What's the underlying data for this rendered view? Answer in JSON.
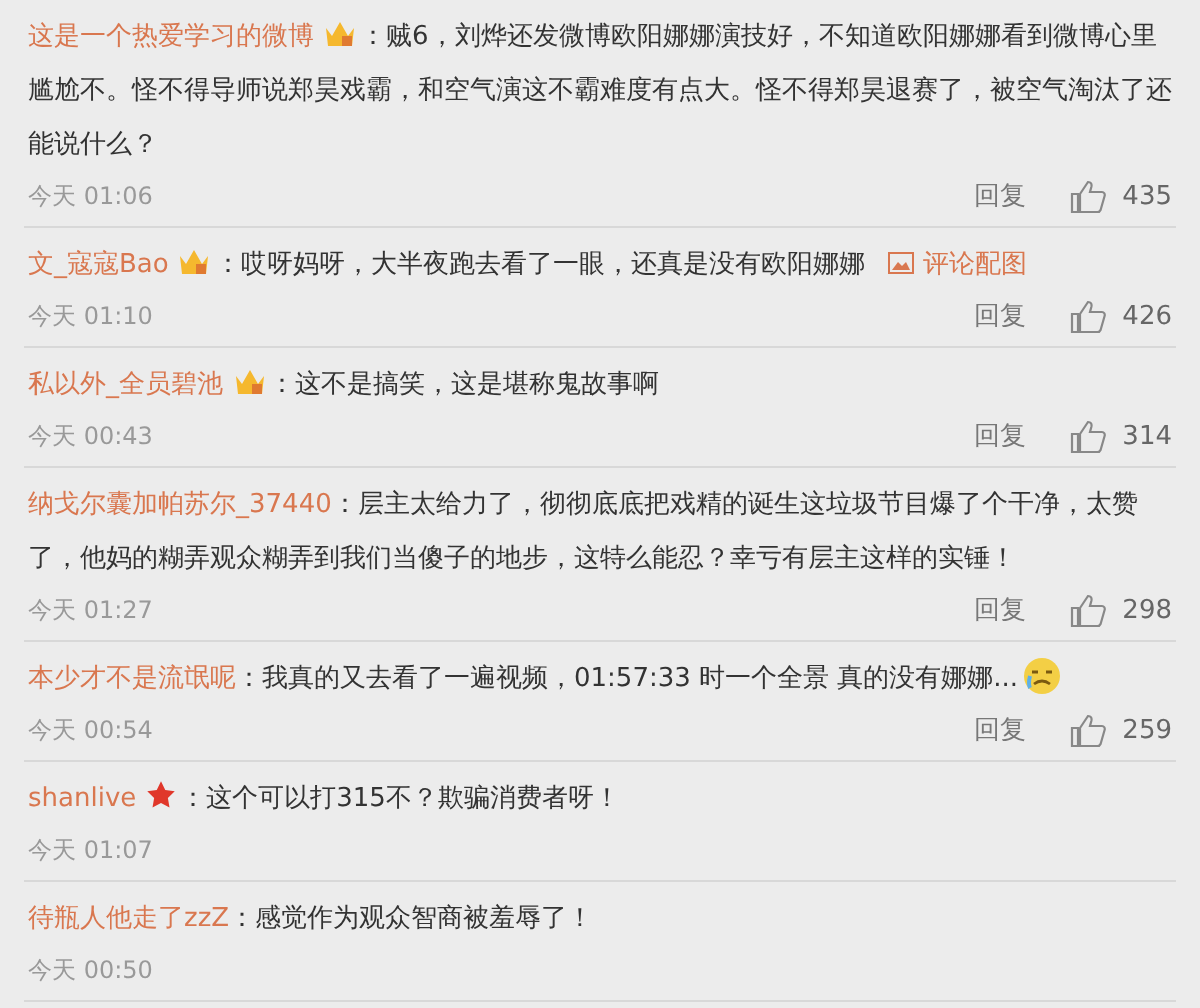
{
  "comments": [
    {
      "user": "这是一个热爱学习的微博",
      "badge": {
        "kind": "vip"
      },
      "text": "：贼6，刘烨还发微博欧阳娜娜演技好，不知道欧阳娜娜看到微博心里尴尬不。怪不得导师说郑昊戏霸，和空气演这不霸难度有点大。怪不得郑昊退赛了，被空气淘汰了还能说什么？",
      "time": "今天 01:06",
      "reply": "回复",
      "likes": "435"
    },
    {
      "user": "文_寇寇Bao",
      "badge": {
        "kind": "vip"
      },
      "text": "：哎呀妈呀，大半夜跑去看了一眼，还真是没有欧阳娜娜",
      "attachment": "评论配图",
      "time": "今天 01:10",
      "reply": "回复",
      "likes": "426"
    },
    {
      "user": "私以外_全员碧池",
      "badge": {
        "kind": "vip"
      },
      "text": "：这不是搞笑，这是堪称鬼故事啊",
      "time": "今天 00:43",
      "reply": "回复",
      "likes": "314"
    },
    {
      "user": "纳戈尔囊加帕苏尔_37440",
      "text": "：层主太给力了，彻彻底底把戏精的诞生这垃圾节目爆了个干净，太赞了，他妈的糊弄观众糊弄到我们当傻子的地步，这特么能忍？幸亏有层主这样的实锤！",
      "time": "今天 01:27",
      "reply": "回复",
      "likes": "298"
    },
    {
      "user": "本少才不是流氓呢",
      "text": "：我真的又去看了一遍视频，01:57:33 时一个全景 真的没有娜娜...",
      "emoji": true,
      "time": "今天 00:54",
      "reply": "回复",
      "likes": "259"
    },
    {
      "user": "shanlive",
      "badge": {
        "kind": "star"
      },
      "text": "：这个可以打315不？欺骗消费者呀！",
      "time": "今天 01:07"
    },
    {
      "user": "待瓶人他走了zzZ",
      "text": "：感觉作为观众智商被羞辱了！",
      "time": "今天 00:50"
    }
  ]
}
